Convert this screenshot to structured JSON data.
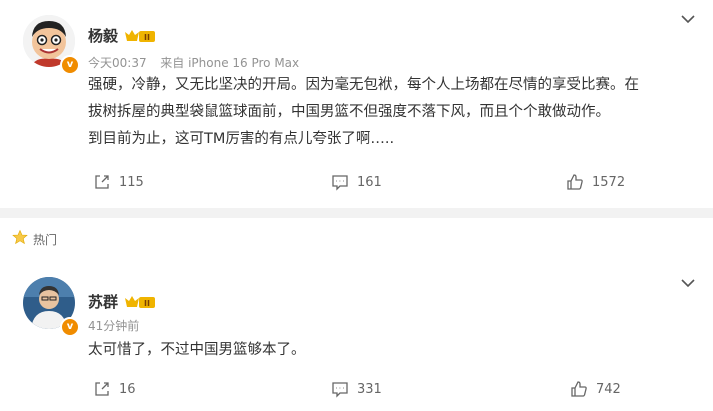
{
  "posts": [
    {
      "username": "杨毅",
      "level_badge": "II",
      "meta_time": "今天00:37",
      "meta_source": "来自 iPhone 16 Pro Max",
      "content_lines": [
        "强硬，冷静，又无比坚决的开局。因为毫无包袱，每个人上场都在尽情的享受比赛。在",
        "拔树拆屋的典型袋鼠篮球面前，中国男篮不但强度不落下风，而且个个敢做动作。",
        "到目前为止，这可TM厉害的有点儿夸张了啊….."
      ],
      "shares": "115",
      "comments": "161",
      "likes": "1572"
    },
    {
      "username": "苏群",
      "level_badge": "II",
      "meta_time": "41分钟前",
      "content_lines": [
        "太可惜了，不过中国男篮够本了。"
      ],
      "shares": "16",
      "comments": "331",
      "likes": "742"
    }
  ],
  "section": {
    "hot_label": "热门"
  },
  "verified_mark": "v",
  "colors": {
    "badge_gold": "#f0b400",
    "verified_orange": "#f08c00",
    "text_gray": "#939393"
  },
  "icons": [
    "chevron-down-icon",
    "share-icon",
    "comment-icon",
    "like-icon",
    "star-icon"
  ]
}
